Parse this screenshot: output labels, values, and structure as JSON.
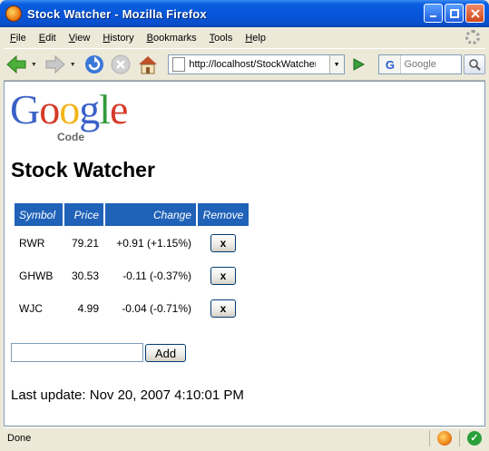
{
  "window": {
    "title": "Stock Watcher - Mozilla Firefox"
  },
  "menu": [
    {
      "key": "F",
      "rest": "ile"
    },
    {
      "key": "E",
      "rest": "dit"
    },
    {
      "key": "V",
      "rest": "iew"
    },
    {
      "key": "H",
      "rest": "istory"
    },
    {
      "key": "B",
      "rest": "ookmarks"
    },
    {
      "key": "T",
      "rest": "ools"
    },
    {
      "key": "H",
      "rest": "elp"
    }
  ],
  "toolbar": {
    "url": "http://localhost/StockWatcher",
    "search_placeholder": "Google"
  },
  "logo": {
    "letters": [
      "G",
      "o",
      "o",
      "g",
      "l",
      "e"
    ],
    "colors": [
      "#3a62c8",
      "#d53b2a",
      "#f2b51b",
      "#3a62c8",
      "#2e9b3a",
      "#d53b2a"
    ],
    "sub": "Code"
  },
  "page": {
    "title": "Stock Watcher",
    "headers": {
      "symbol": "Symbol",
      "price": "Price",
      "change": "Change",
      "remove": "Remove"
    },
    "rows": [
      {
        "symbol": "RWR",
        "price": "79.21",
        "change": "+0.91 (+1.15%)",
        "trend": "pos",
        "remove": "x"
      },
      {
        "symbol": "GHWB",
        "price": "30.53",
        "change": "-0.11 (-0.37%)",
        "trend": "neg",
        "remove": "x"
      },
      {
        "symbol": "WJC",
        "price": "4.99",
        "change": "-0.04 (-0.71%)",
        "trend": "neg",
        "remove": "x"
      }
    ],
    "add_label": "Add",
    "new_symbol_value": "",
    "last_update": "Last update: Nov 20, 2007 4:10:01 PM"
  },
  "status": {
    "text": "Done"
  },
  "colors": {
    "accent": "#2062b8",
    "positive": "#0a8a0a",
    "negative": "#d01010"
  }
}
